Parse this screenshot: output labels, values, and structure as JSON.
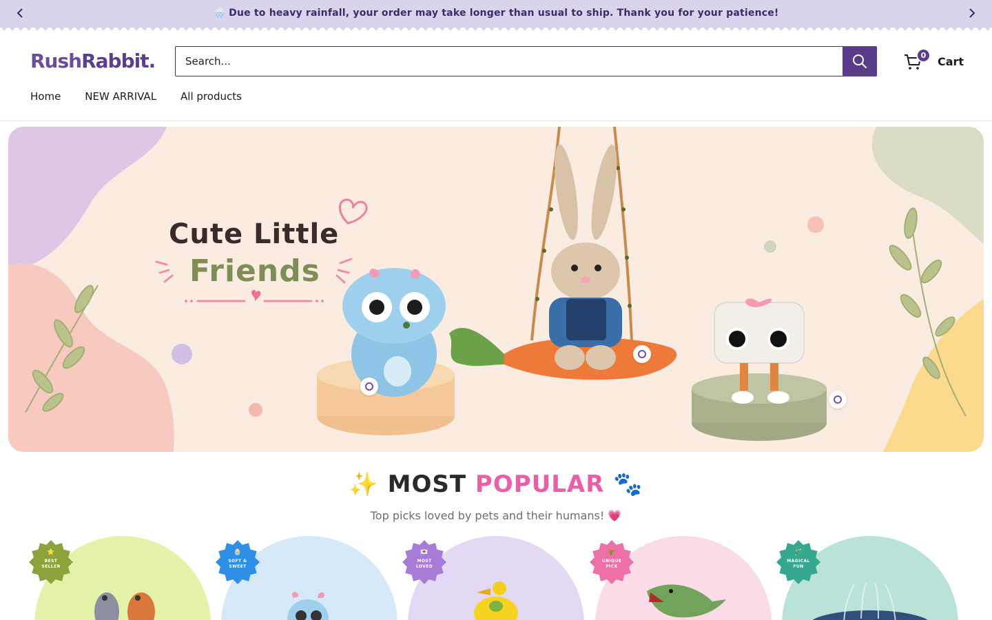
{
  "announcement": {
    "text": "🌧️ Due to heavy rainfall, your order may take longer than usual to ship. Thank you for your patience!",
    "bg_color": "#d9d4ec",
    "prev_icon": "chevron-left-icon",
    "next_icon": "chevron-right-icon"
  },
  "header": {
    "logo_part1": "Rush",
    "logo_part2": "Rabbit.",
    "search_placeholder": "Search...",
    "search_icon": "search-icon",
    "cart_count": "0",
    "cart_label": "Cart",
    "brand_color": "#5a3d8a"
  },
  "nav": {
    "items": [
      {
        "label": "Home"
      },
      {
        "label": "NEW ARRIVAL"
      },
      {
        "label": "All products"
      }
    ]
  },
  "hero": {
    "line1": "Cute Little",
    "line2": "Friends"
  },
  "popular": {
    "title_prefix": "✨",
    "title_word1": "MOST",
    "title_word2": "POPULAR",
    "title_suffix": "🐾",
    "subtitle": "Top picks loved by pets and their humans! 💗",
    "accent_color": "#ec5fa8"
  },
  "cards": [
    {
      "badge_line1": "BEST",
      "badge_line2": "SELLER",
      "badge_emoji": "⭐",
      "badge_color": "#8ba33a",
      "bg_color": "#e4f3a9"
    },
    {
      "badge_line1": "SOFT &",
      "badge_line2": "SWEET",
      "badge_emoji": "🧁",
      "badge_color": "#2f8fe6",
      "bg_color": "#d6e9f8"
    },
    {
      "badge_line1": "MOST",
      "badge_line2": "LOVED",
      "badge_emoji": "💌",
      "badge_color": "#a77cd6",
      "bg_color": "#e4d9f5"
    },
    {
      "badge_line1": "UNIQUE",
      "badge_line2": "PICK",
      "badge_emoji": "🦖",
      "badge_color": "#ec6fa6",
      "bg_color": "#fadbe8"
    },
    {
      "badge_line1": "MAGICAL",
      "badge_line2": "FUN",
      "badge_emoji": "🪄",
      "badge_color": "#36a890",
      "bg_color": "#b9e3d9"
    }
  ]
}
